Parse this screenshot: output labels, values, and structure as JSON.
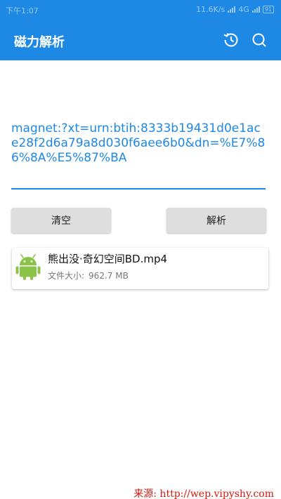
{
  "status_bar": {
    "time": "下午1:07",
    "speed": "11.6K/s",
    "network": "4G",
    "battery": "91"
  },
  "app_bar": {
    "title": "磁力解析",
    "history_icon": "history-icon",
    "search_icon": "search-icon"
  },
  "magnet": {
    "value": "magnet:?xt=urn:btih:8333b19431d0e1ace28f2d6a79a8d030f6aee6b0&dn=%E7%86%8A%E5%87%BA"
  },
  "buttons": {
    "clear_label": "清空",
    "parse_label": "解析"
  },
  "result": {
    "file_name": "熊出没·奇幻空间BD.mp4",
    "size_label": "文件大小:",
    "size_value": "962.7 MB",
    "icon": "android-icon"
  },
  "watermark": {
    "text": "来源: http://wep.vipyshy.com"
  },
  "colors": {
    "accent": "#1e88e5",
    "button_bg": "#dedede",
    "watermark": "#d01b10"
  }
}
